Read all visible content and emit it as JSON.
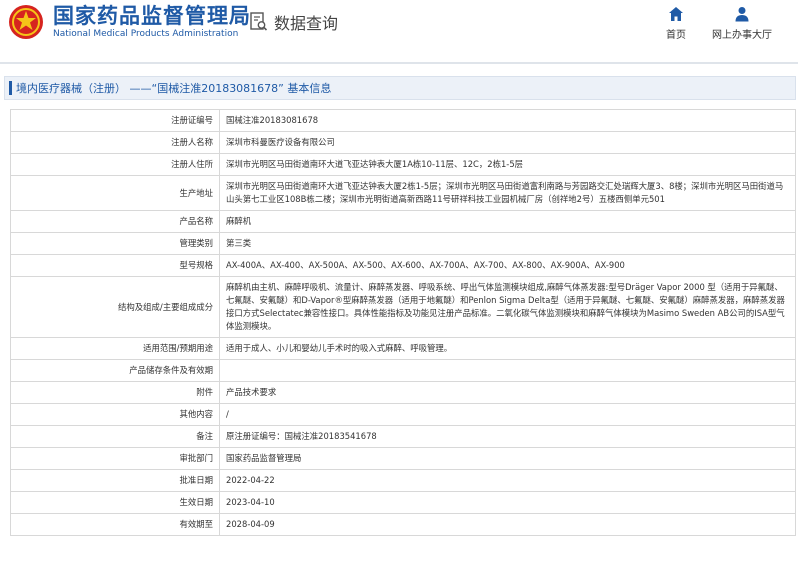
{
  "header": {
    "site_title": "国家药品监督管理局",
    "site_subtitle": "National Medical Products Administration",
    "query_label": "数据查询",
    "nav": {
      "home_label": "首页",
      "office_label": "网上办事大厅"
    }
  },
  "section": {
    "title": "境内医疗器械（注册） ——“国械注准20183081678” 基本信息"
  },
  "colors": {
    "brand_blue": "#1f5aa6",
    "seal_red": "#d6241f",
    "border": "#d8d8d8"
  },
  "rows": [
    {
      "label": "注册证编号",
      "value": "国械注准20183081678"
    },
    {
      "label": "注册人名称",
      "value": "深圳市科曼医疗设备有限公司"
    },
    {
      "label": "注册人住所",
      "value": "深圳市光明区马田街道南环大道飞亚达钟表大厦1A栋10-11层、12C，2栋1-5层"
    },
    {
      "label": "生产地址",
      "value": "深圳市光明区马田街道南环大道飞亚达钟表大厦2栋1-5层；深圳市光明区马田街道富利南路与芳园路交汇处瑞辉大厦3、8楼；深圳市光明区马田街道马山头第七工业区108B栋二楼；深圳市光明街道高新西路11号研祥科技工业园机械厂房（创祥地2号）五楼西侧单元501"
    },
    {
      "label": "产品名称",
      "value": "麻醉机"
    },
    {
      "label": "管理类别",
      "value": "第三类"
    },
    {
      "label": "型号规格",
      "value": "AX-400A、AX-400、AX-500A、AX-500、AX-600、AX-700A、AX-700、AX-800、AX-900A、AX-900"
    },
    {
      "label": "结构及组成/主要组成成分",
      "value": "麻醉机由主机、麻醉呼吸机、流量计、麻醉蒸发器、呼吸系统、呼出气体监测模块组成,麻醉气体蒸发器:型号Dräger Vapor 2000 型（适用于异氟醚、七氟醚、安氟醚）和D-Vapor®型麻醉蒸发器（适用于地氟醚）和Penlon Sigma Delta型（适用于异氟醚、七氟醚、安氟醚）麻醉蒸发器，麻醉蒸发器接口方式Selectatec兼容性接口。具体性能指标及功能见注册产品标准。二氧化碳气体监测模块和麻醉气体模块为Masimo Sweden AB公司的ISA型气体监测模块。"
    },
    {
      "label": "适用范围/预期用途",
      "value": "适用于成人、小儿和婴幼儿手术时的吸入式麻醉、呼吸管理。"
    },
    {
      "label": "产品储存条件及有效期",
      "value": ""
    },
    {
      "label": "附件",
      "value": "产品技术要求"
    },
    {
      "label": "其他内容",
      "value": "/"
    },
    {
      "label": "备注",
      "value": "原注册证编号：国械注准20183541678"
    },
    {
      "label": "审批部门",
      "value": "国家药品监督管理局"
    },
    {
      "label": "批准日期",
      "value": "2022-04-22"
    },
    {
      "label": "生效日期",
      "value": "2023-04-10"
    },
    {
      "label": "有效期至",
      "value": "2028-04-09"
    }
  ]
}
